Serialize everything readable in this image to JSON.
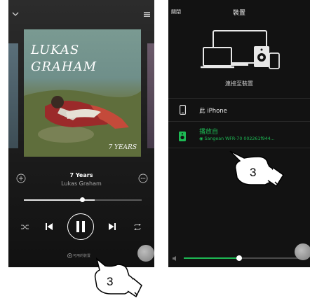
{
  "player": {
    "album_art_title": "LUKAS GRAHAM",
    "album_art_subtitle": "7 YEARS",
    "track_title": "7 Years",
    "track_artist": "Lukas Graham",
    "progress": 0.6,
    "devices_available_label": "可用的裝置"
  },
  "devices": {
    "close_label": "關閉",
    "title": "裝置",
    "connect_label": "連接至裝置",
    "this_phone_label": "此 iPhone",
    "playing_from_label": "播放自",
    "current_device_label": "Sangean WFR-70 002261f944...",
    "volume": 0.48
  },
  "callouts": {
    "left_step": "3",
    "right_step": "3"
  },
  "colors": {
    "accent_green": "#1db954",
    "background": "#121212"
  }
}
